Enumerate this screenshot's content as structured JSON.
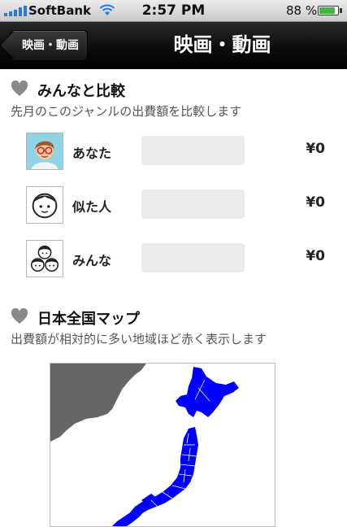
{
  "status_bar": {
    "carrier": "SoftBank",
    "time": "2:57 PM",
    "battery": "88 %",
    "battery_level": 0.88
  },
  "nav": {
    "back_label": "映画・動画",
    "title": "映画・動画"
  },
  "compare": {
    "title": "みんなと比較",
    "description": "先月のこのジャンルの出費額を比較します",
    "rows": [
      {
        "label": "あなた",
        "amount": "¥0",
        "icon": "user-photo-icon"
      },
      {
        "label": "似た人",
        "amount": "¥0",
        "icon": "person-face-icon"
      },
      {
        "label": "みんな",
        "amount": "¥0",
        "icon": "people-group-icon"
      }
    ]
  },
  "map": {
    "title": "日本全国マップ",
    "description": "出費額が相対的に多い地域ほど赤く表示します"
  },
  "colors": {
    "nav_bar": "#000000",
    "heart": "#8a8a8a",
    "region_fill": "#0000ff",
    "map_land_outline": "#666666",
    "bar_background": "#ebebeb"
  }
}
